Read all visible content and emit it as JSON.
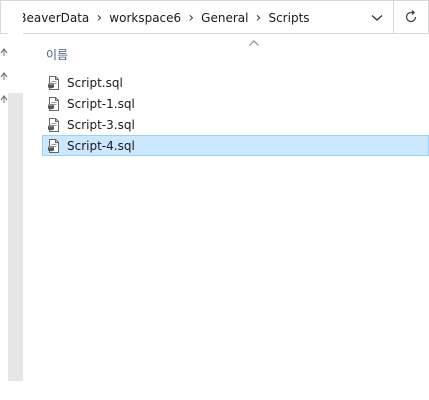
{
  "address_bar": {
    "breadcrumbs": [
      {
        "label": "DBeaverData"
      },
      {
        "label": "workspace6"
      },
      {
        "label": "General"
      },
      {
        "label": "Scripts"
      }
    ],
    "dropdown_icon": "chevron-down-icon",
    "refresh_icon": "refresh-icon"
  },
  "file_list": {
    "column_header": "이름",
    "sort_indicator": "sort-ascending-caret",
    "files": [
      {
        "name": "Script.sql",
        "icon": "sql-file-icon",
        "selected": false
      },
      {
        "name": "Script-1.sql",
        "icon": "sql-file-icon",
        "selected": false
      },
      {
        "name": "Script-3.sql",
        "icon": "sql-file-icon",
        "selected": false
      },
      {
        "name": "Script-4.sql",
        "icon": "sql-file-icon",
        "selected": true
      }
    ]
  },
  "colors": {
    "selection_bg": "#cce8ff",
    "selection_border": "#99d1ff",
    "header_text": "#4c607a"
  }
}
